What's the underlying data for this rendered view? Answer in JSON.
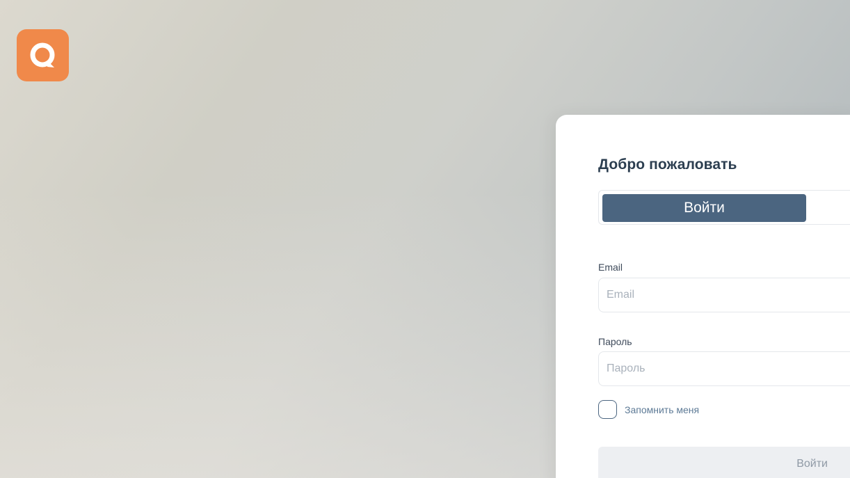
{
  "app": {
    "logo_icon": "chat-q-logo-icon",
    "logo_color": "#f0894a"
  },
  "login": {
    "title": "Добро пожаловать",
    "tabs": [
      {
        "label": "Войти",
        "active": true
      }
    ],
    "email": {
      "label": "Email",
      "placeholder": "Email",
      "value": ""
    },
    "password": {
      "label": "Пароль",
      "placeholder": "Пароль",
      "value": ""
    },
    "remember": {
      "label": "Запомнить меня",
      "checked": false
    },
    "submit_label": "Войти"
  },
  "colors": {
    "accent": "#4b6580",
    "title": "#2c3e50",
    "muted_button": "#edeff2"
  }
}
